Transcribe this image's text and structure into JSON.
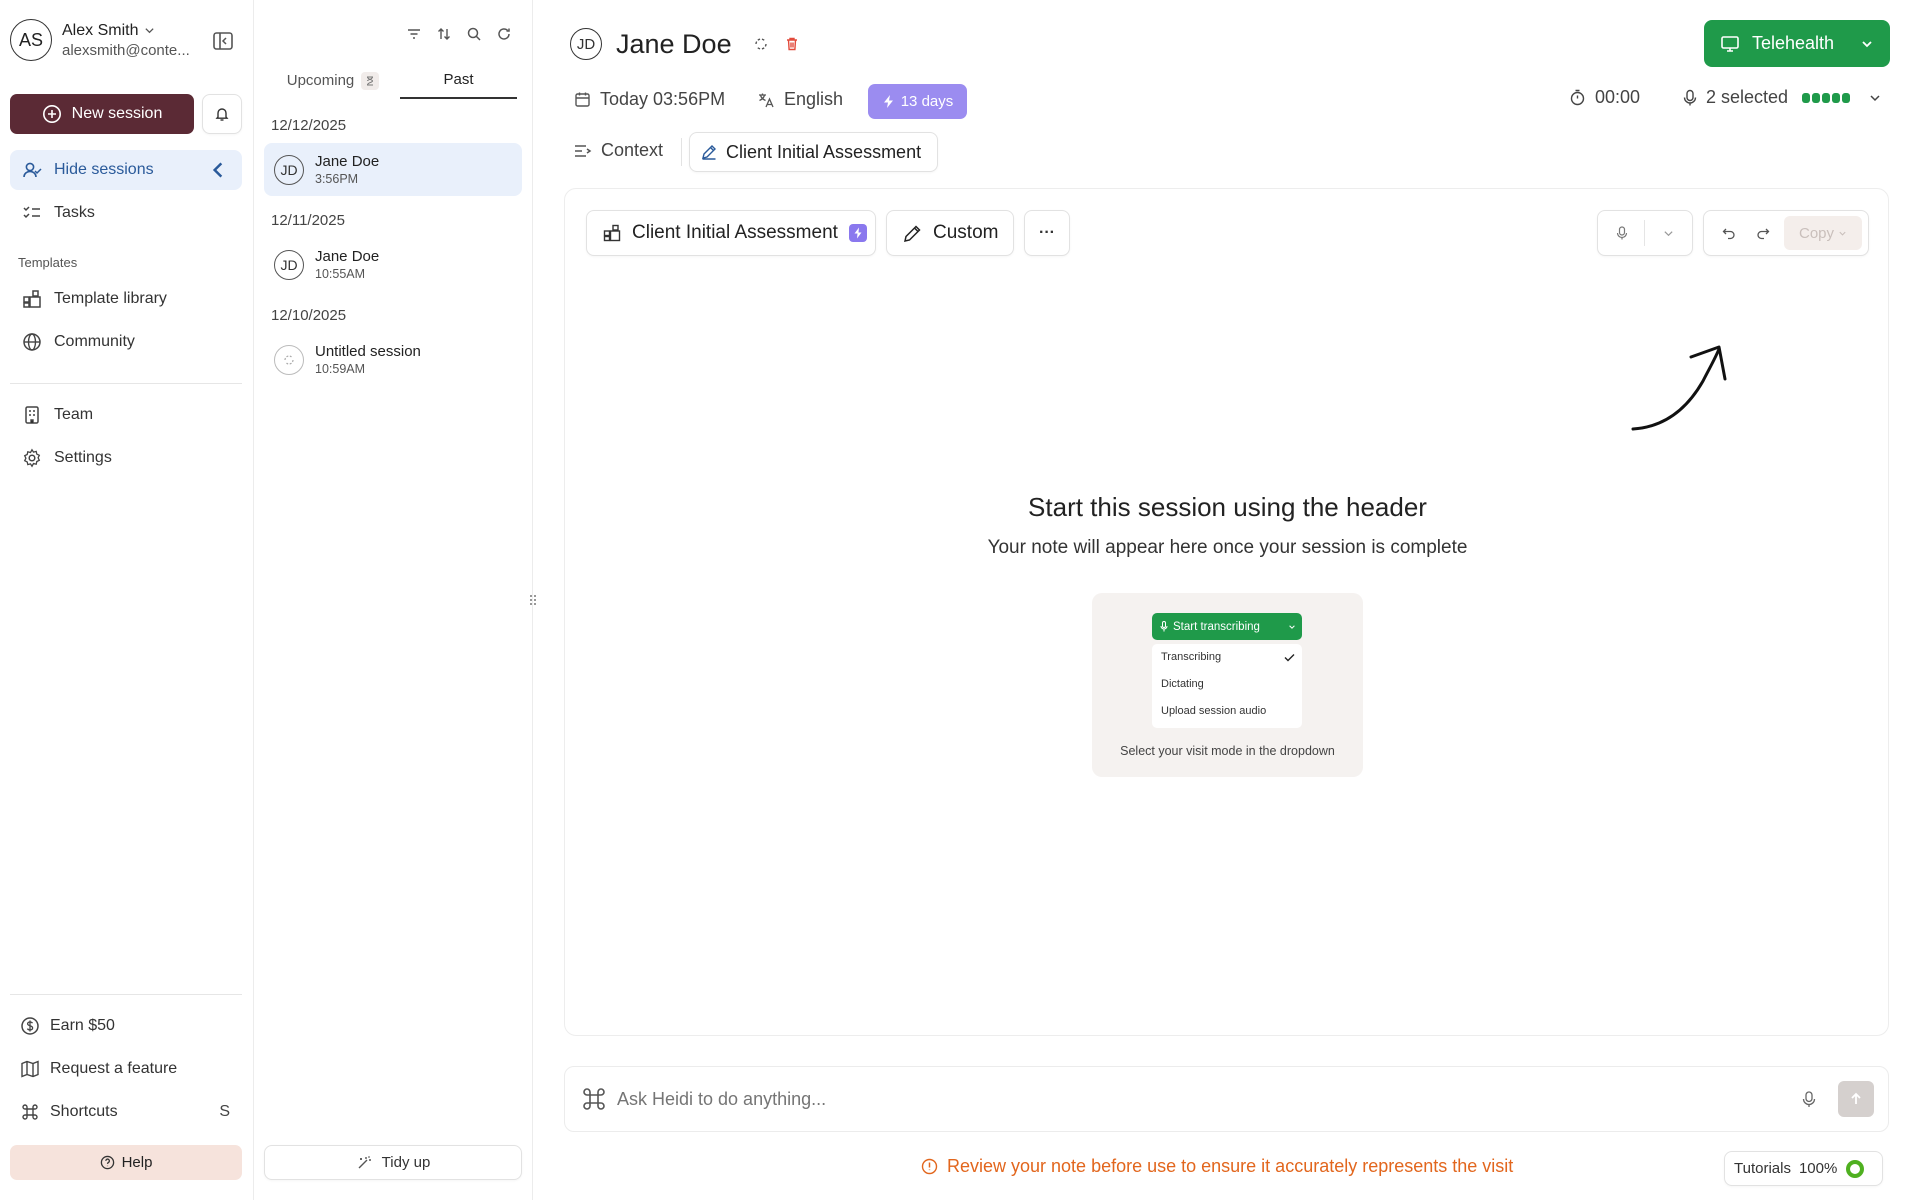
{
  "user": {
    "initials": "AS",
    "name": "Alex Smith",
    "email": "alexsmith@conte..."
  },
  "sidebar": {
    "new_session": "New session",
    "hide_sessions": "Hide sessions",
    "tasks": "Tasks",
    "templates_heading": "Templates",
    "template_library": "Template library",
    "community": "Community",
    "team": "Team",
    "settings": "Settings",
    "earn": "Earn $50",
    "request_feature": "Request a feature",
    "shortcuts": "Shortcuts",
    "shortcuts_key": "S",
    "help": "Help"
  },
  "sessions": {
    "tab_upcoming": "Upcoming",
    "tab_past": "Past",
    "groups": [
      {
        "date": "12/12/2025",
        "name": "Jane Doe",
        "time": "3:56PM",
        "initials": "JD"
      },
      {
        "date": "12/11/2025",
        "name": "Jane Doe",
        "time": "10:55AM",
        "initials": "JD"
      },
      {
        "date": "12/10/2025",
        "name": "Untitled session",
        "time": "10:59AM"
      }
    ],
    "tidy_up": "Tidy up"
  },
  "header": {
    "patient_initials": "JD",
    "patient_name": "Jane Doe",
    "telehealth": "Telehealth",
    "date": "Today 03:56PM",
    "language": "English",
    "days_badge": "13 days",
    "timer": "00:00",
    "mic_selected": "2 selected",
    "tab_context": "Context",
    "tab_assessment": "Client Initial Assessment"
  },
  "note": {
    "template_button": "Client Initial Assessment",
    "custom_button": "Custom",
    "more_button": "···",
    "copy_button": "Copy",
    "empty_title": "Start this session using the header",
    "empty_subtitle": "Your note will appear here once your session is complete",
    "demo_button": "Start transcribing",
    "demo_options": [
      "Transcribing",
      "Dictating",
      "Upload session audio"
    ],
    "demo_caption": "Select your visit mode in the dropdown"
  },
  "chat": {
    "placeholder": "Ask Heidi to do anything..."
  },
  "footer": {
    "warning": "Review your note before use to ensure it accurately represents the visit",
    "tutorials": "Tutorials",
    "progress": "100%"
  },
  "colors": {
    "brand_dark": "#5b2a35",
    "telehealth_green": "#1f9a4a",
    "badge_purple": "#9b8cf0",
    "warning_orange": "#e2661d",
    "active_blue": "#e9f0fb"
  }
}
